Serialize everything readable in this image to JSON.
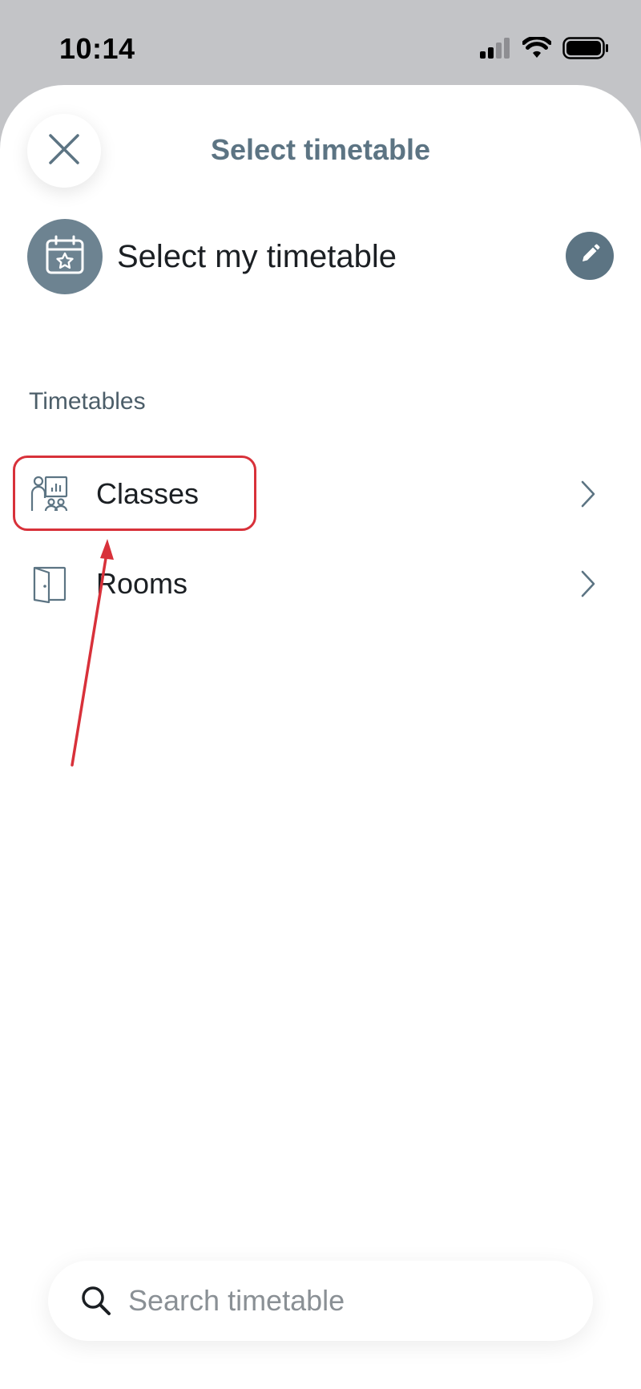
{
  "status_bar": {
    "time": "10:14"
  },
  "header": {
    "title": "Select timetable",
    "close_icon": "close-icon"
  },
  "my_timetable": {
    "label": "Select my timetable",
    "icon": "calendar-star-icon",
    "edit_icon": "pencil-icon"
  },
  "timetables": {
    "section_label": "Timetables",
    "items": [
      {
        "label": "Classes",
        "icon": "class-presentation-icon"
      },
      {
        "label": "Rooms",
        "icon": "door-icon"
      }
    ]
  },
  "search": {
    "placeholder": "Search timetable",
    "value": ""
  },
  "colors": {
    "accent": "#5c7483",
    "avatar_bg": "#6d8391",
    "annotation_red": "#d8313a",
    "status_bg": "#c3c4c7"
  }
}
